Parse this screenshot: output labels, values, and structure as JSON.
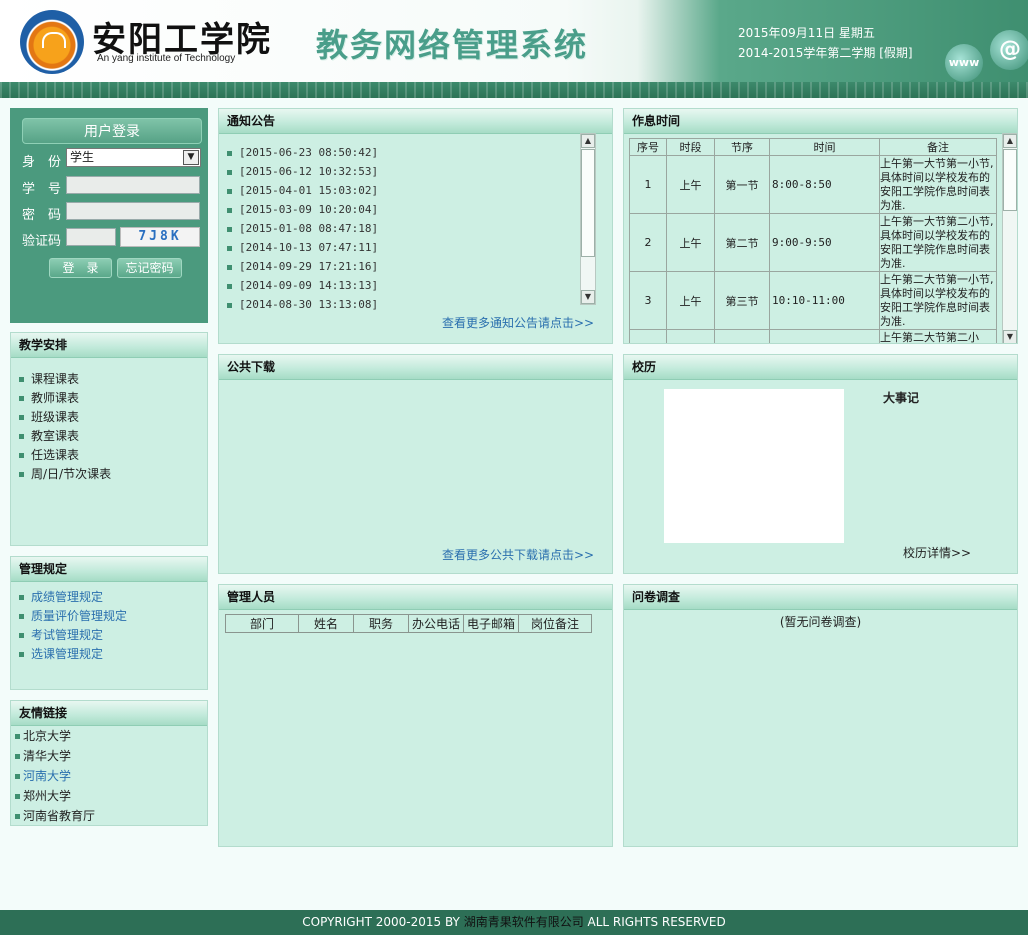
{
  "header": {
    "school_cn": "安阳工学院",
    "school_en": "An yang institute of Technology",
    "system_title": "教务网络管理系统",
    "date": "2015年09月11日 星期五",
    "term": "2014-2015学年第二学期 [假期]",
    "icons": [
      "school-logo",
      "www-icon",
      "at-icon"
    ]
  },
  "login": {
    "title": "用户登录",
    "identity_label": "身　份",
    "identity_value": "学生",
    "id_label": "学　号",
    "password_label": "密　码",
    "captcha_label": "验证码",
    "captcha_image_text": "7J8K",
    "login_button": "登　录",
    "forgot_button": "忘记密码"
  },
  "teaching": {
    "title": "教学安排",
    "items": [
      "课程课表",
      "教师课表",
      "班级课表",
      "教室课表",
      "任选课表",
      "周/日/节次课表"
    ]
  },
  "rules": {
    "title": "管理规定",
    "items": [
      "成绩管理规定",
      "质量评价管理规定",
      "考试管理规定",
      "选课管理规定"
    ]
  },
  "links": {
    "title": "友情链接",
    "items": [
      "北京大学",
      "清华大学",
      "河南大学",
      "郑州大学",
      "河南省教育厅"
    ]
  },
  "notices": {
    "title": "通知公告",
    "items": [
      "[2015-06-23 08:50:42]",
      "[2015-06-12 10:32:53]",
      "[2015-04-01 15:03:02]",
      "[2015-03-09 10:20:04]",
      "[2015-01-08 08:47:18]",
      "[2014-10-13 07:47:11]",
      "[2014-09-29 17:21:16]",
      "[2014-09-09 14:13:13]",
      "[2014-08-30 13:13:08]"
    ],
    "more": "查看更多通知公告请点击>>"
  },
  "schedule": {
    "title": "作息时间",
    "headers": [
      "序号",
      "时段",
      "节序",
      "时间",
      "备注"
    ],
    "rows": [
      {
        "no": "1",
        "period": "上午",
        "section": "第一节",
        "time": "8:00-8:50",
        "note": "上午第一大节第一小节,具体时间以学校发布的安阳工学院作息时间表为准."
      },
      {
        "no": "2",
        "period": "上午",
        "section": "第二节",
        "time": "9:00-9:50",
        "note": "上午第一大节第二小节,具体时间以学校发布的安阳工学院作息时间表为准."
      },
      {
        "no": "3",
        "period": "上午",
        "section": "第三节",
        "time": "10:10-11:00",
        "note": "上午第二大节第一小节,具体时间以学校发布的安阳工学院作息时间表为准."
      }
    ],
    "partial_note": "上午第二大节第二小"
  },
  "downloads": {
    "title": "公共下载",
    "more": "查看更多公共下载请点击>>"
  },
  "calendar": {
    "title": "校历",
    "events": "大事记",
    "details": "校历详情>>"
  },
  "staff": {
    "title": "管理人员",
    "headers": [
      "部门",
      "姓名",
      "职务",
      "办公电话",
      "电子邮箱",
      "岗位备注"
    ]
  },
  "survey": {
    "title": "问卷调查",
    "empty": "(暂无问卷调查)"
  },
  "footer": {
    "prefix": "COPYRIGHT 2000-2015 BY ",
    "company": "湖南青果软件有限公司",
    "suffix": " ALL RIGHTS RESERVED"
  },
  "colors": {
    "brand_green": "#2d6f56",
    "panel_bg": "#cdefe3",
    "link_blue": "#2a6fae"
  }
}
